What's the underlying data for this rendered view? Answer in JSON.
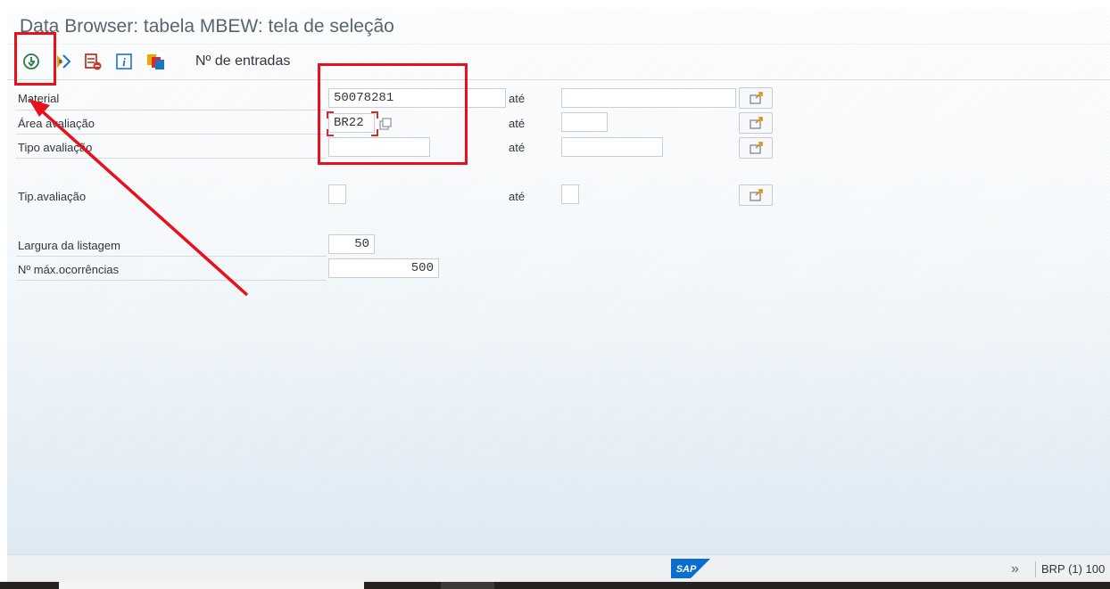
{
  "window": {
    "title": "Data Browser: tabela MBEW: tela de seleção"
  },
  "toolbar": {
    "execute_icon": "execute-clock-icon",
    "selection_icon": "selection-options-icon",
    "delete_icon": "delete-selection-icon",
    "info_icon": "info-icon",
    "multi_icon": "multiple-selection-icon",
    "entries_label": "Nº de entradas"
  },
  "form": {
    "to_label": "até",
    "rows": [
      {
        "label": "Material",
        "from": "50078281",
        "to": ""
      },
      {
        "label": "Área avaliação",
        "from": "BR22",
        "to": ""
      },
      {
        "label": "Tipo avaliação",
        "from": "",
        "to": ""
      },
      {
        "label": "Tip.avaliação",
        "from": "",
        "to": ""
      }
    ],
    "list_width": {
      "label": "Largura da listagem",
      "value": "50"
    },
    "max_hits": {
      "label": "Nº máx.ocorrências",
      "value": "500"
    }
  },
  "statusbar": {
    "logo": "SAP",
    "arrows": "»",
    "system": "BRP (1) 100"
  },
  "colors": {
    "annotation": "#e8101a",
    "sap_blue": "#0a6ed1"
  }
}
